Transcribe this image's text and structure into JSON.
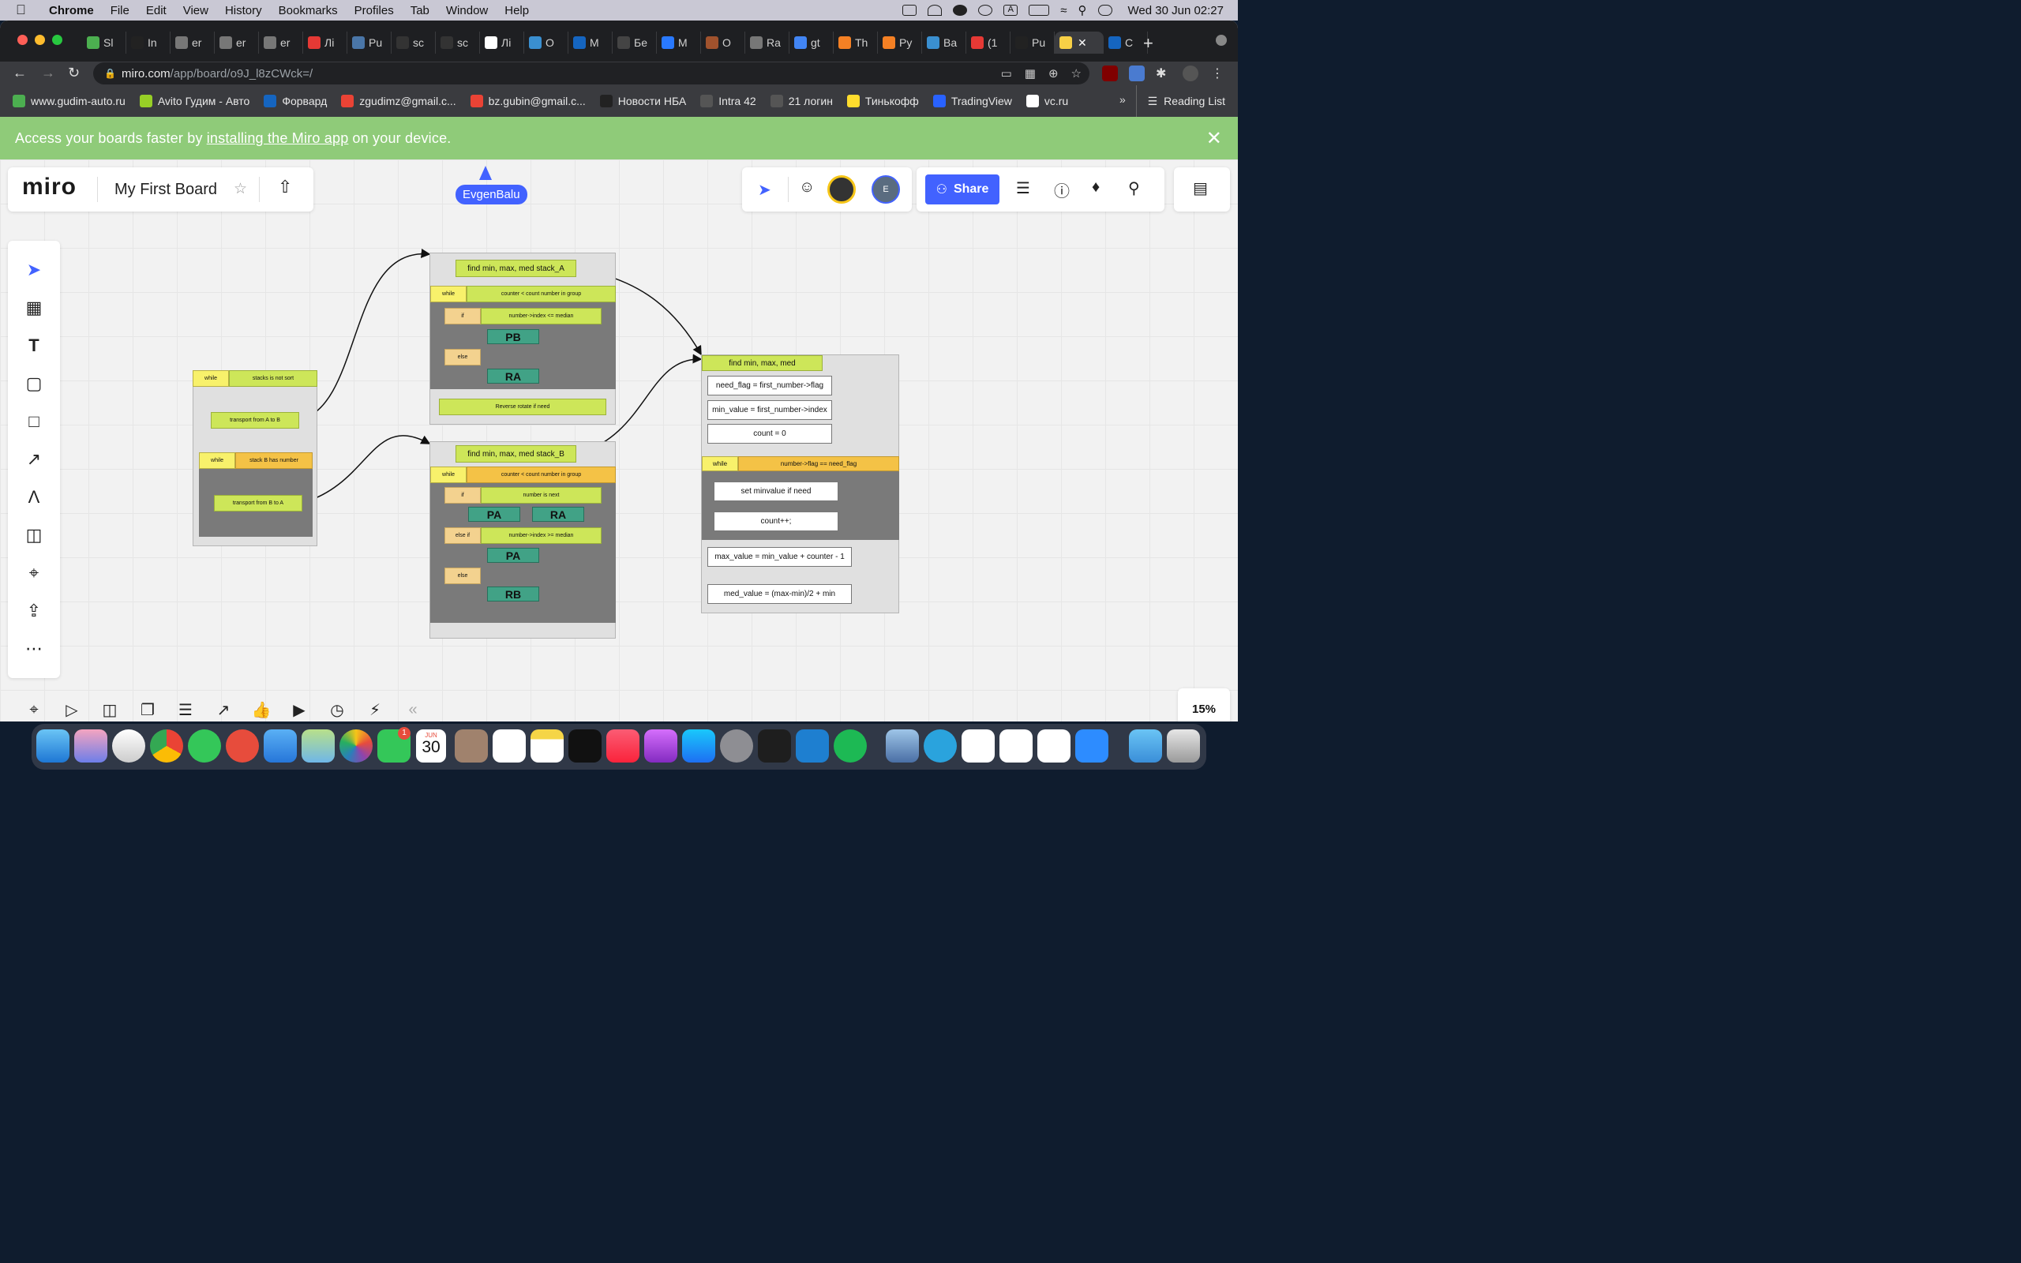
{
  "menubar": {
    "app": "Chrome",
    "menus": [
      "File",
      "Edit",
      "View",
      "History",
      "Bookmarks",
      "Profiles",
      "Tab",
      "Window",
      "Help"
    ],
    "clock": "Wed 30 Jun  02:27"
  },
  "tabs": [
    {
      "label": "Sl",
      "color": "#4caf50"
    },
    {
      "label": "In",
      "color": "#222"
    },
    {
      "label": "er",
      "color": "#777"
    },
    {
      "label": "er",
      "color": "#777"
    },
    {
      "label": "er",
      "color": "#777"
    },
    {
      "label": "Лі",
      "color": "#e53935"
    },
    {
      "label": "Рu",
      "color": "#4a76a8"
    },
    {
      "label": "sc",
      "color": "#333"
    },
    {
      "label": "sc",
      "color": "#333"
    },
    {
      "label": "Лі",
      "color": "#fff"
    },
    {
      "label": "O",
      "color": "#3a8fd0"
    },
    {
      "label": "M",
      "color": "#1565c0"
    },
    {
      "label": "Бе",
      "color": "#444"
    },
    {
      "label": "M",
      "color": "#2979ff"
    },
    {
      "label": "O",
      "color": "#a0522d"
    },
    {
      "label": "Ra",
      "color": "#777"
    },
    {
      "label": "gt",
      "color": "#4285f4"
    },
    {
      "label": "Th",
      "color": "#f48024"
    },
    {
      "label": "Py",
      "color": "#f48024"
    },
    {
      "label": "Ba",
      "color": "#3a8fd0"
    },
    {
      "label": "(1",
      "color": "#e53935"
    },
    {
      "label": "Pu",
      "color": "#222"
    }
  ],
  "active_tab": {
    "label": "",
    "color": "#f7d046"
  },
  "extra_tab": {
    "label": "C",
    "color": "#1565c0"
  },
  "address": {
    "host": "miro.com",
    "path": "/app/board/o9J_l8zCWck=/"
  },
  "bookmarks": [
    {
      "label": "www.gudim-auto.ru",
      "color": "#4caf50"
    },
    {
      "label": "Avito Гудим - Авто",
      "color": "#97cf26"
    },
    {
      "label": "Форвард",
      "color": "#1565c0"
    },
    {
      "label": "zgudimz@gmail.c...",
      "color": "#ea4335"
    },
    {
      "label": "bz.gubin@gmail.c...",
      "color": "#ea4335"
    },
    {
      "label": "Новости НБА",
      "color": "#222"
    },
    {
      "label": "Intra 42",
      "color": "#555"
    },
    {
      "label": "21 логин",
      "color": "#555"
    },
    {
      "label": "Тинькофф",
      "color": "#ffdd2d"
    },
    {
      "label": "TradingView",
      "color": "#2962ff"
    },
    {
      "label": "vc.ru",
      "color": "#fff"
    }
  ],
  "reading_list": "Reading List",
  "banner": {
    "before": "Access your boards faster by",
    "link": "installing the Miro app",
    "after": "on your device."
  },
  "miro": {
    "logo": "miro",
    "board_name": "My First Board",
    "collaborator": "EvgenBalu",
    "avatar_initial": "E",
    "share": "Share",
    "zoom": "15%"
  },
  "diagram": {
    "main": {
      "while": "while",
      "cond": "stacks is not sort",
      "transport_ab": "transport from A to B",
      "inner_while": "while",
      "inner_cond": "stack B has number",
      "transport_ba": "transport from B to A"
    },
    "stack_a": {
      "title": "find min, max, med stack_A",
      "while": "while",
      "cond": "counter < count number in group",
      "if": "if",
      "if_cond": "number->index <= median",
      "op1": "PB",
      "else": "else",
      "op2": "RA",
      "footer": "Reverse rotate if need"
    },
    "stack_b": {
      "title": "find min, max, med stack_B",
      "while": "while",
      "cond": "counter < count number in group",
      "if": "if",
      "if_cond": "number is next",
      "op_pa": "PA",
      "op_ra": "RA",
      "elseif": "else if",
      "elseif_cond": "number->index >= median",
      "op_pa2": "PA",
      "else": "else",
      "op_rb": "RB"
    },
    "func": {
      "title": "find min, max, med",
      "l1": "need_flag = first_number->flag",
      "l2": "min_value = first_number->index",
      "l3": "count = 0",
      "while": "while",
      "cond": "number->flag == need_flag",
      "b1": "set minvalue if need",
      "b2": "count++;",
      "l4": "max_value = min_value + counter - 1",
      "l5": "med_value = (max-min)/2 + min"
    }
  },
  "dock": {
    "calendar_month": "JUN",
    "calendar_day": "30",
    "facetime_badge": "1"
  }
}
